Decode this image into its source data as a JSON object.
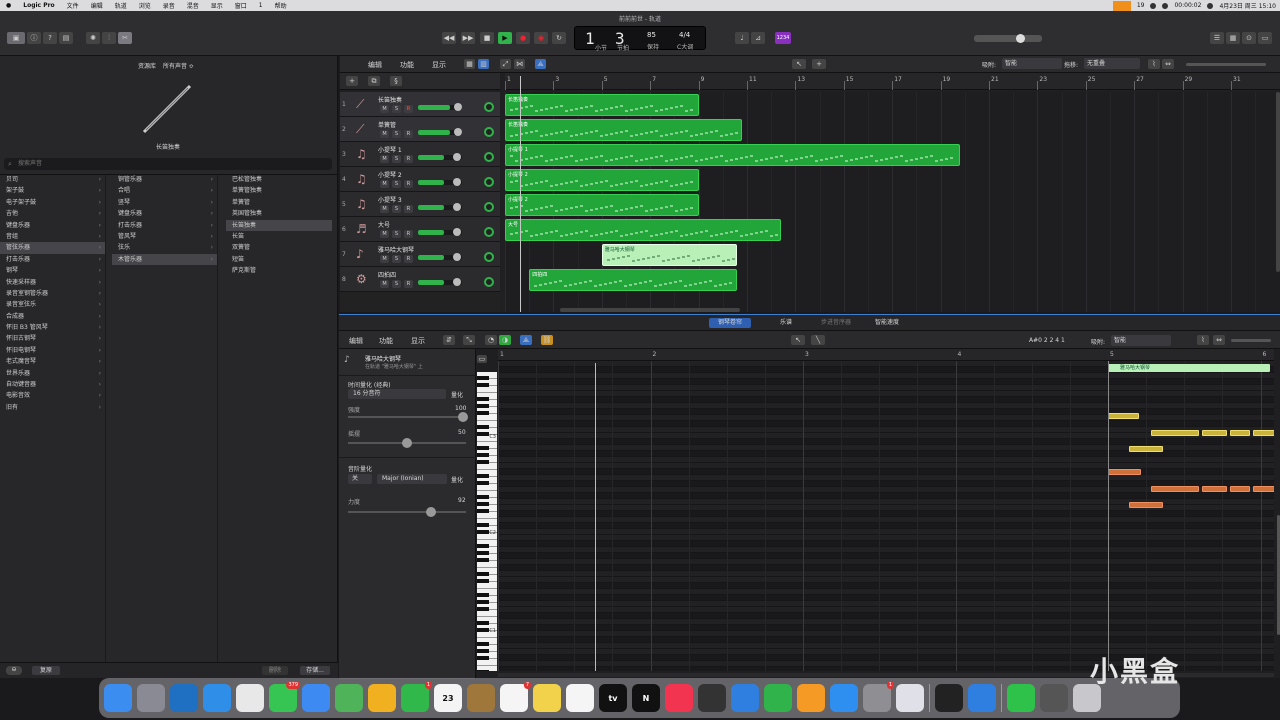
{
  "menubar": {
    "items": [
      "Logic Pro",
      "文件",
      "编辑",
      "轨道",
      "浏览",
      "录音",
      "混音",
      "显示",
      "窗口",
      "1",
      "帮助"
    ],
    "status": {
      "battery": "19",
      "date": "4月23日 周三 15:10",
      "clock": "00:00:02"
    }
  },
  "window": {
    "title": "前前前世 - 轨道"
  },
  "lcd": {
    "bar": "1",
    "beat": "3",
    "tempo": "85",
    "time_sig": "4/4",
    "key": "C大调",
    "bar_label": "小节",
    "beat_label": "节拍",
    "tempo_label": "保持"
  },
  "count_in": "1234",
  "library": {
    "header": "资源库",
    "filter": "所有声音 ≎",
    "instrument_name": "长笛独奏",
    "search_placeholder": "搜索声音",
    "col1": [
      "贝司",
      "架子鼓",
      "电子架子鼓",
      "吉他",
      "键盘乐器",
      "音组",
      "管弦乐器",
      "打击乐器",
      "钢琴",
      "快速采样器",
      "录音室钢管乐器",
      "录音室弦乐",
      "合成器",
      "怀旧 B3 管风琴",
      "怀旧古钢琴",
      "怀旧电钢琴",
      "老式魔音琴",
      "世界乐器",
      "自动键音器",
      "电影音效",
      "旧有"
    ],
    "col2": [
      "铜管乐器",
      "合唱",
      "竖琴",
      "键盘乐器",
      "打击乐器",
      "管风琴",
      "弦乐",
      "木管乐器"
    ],
    "col3": [
      "巴松管独奏",
      "单簧管独奏",
      "单簧管",
      "英国管独奏",
      "长笛独奏",
      "长笛",
      "双簧管",
      "短笛",
      "萨克斯管"
    ],
    "selected": {
      "col1": "管弦乐器",
      "col2": "木管乐器",
      "col3": "长笛独奏"
    },
    "footer": {
      "revert": "复原",
      "delete": "删除",
      "save": "存储..."
    }
  },
  "arrange": {
    "menus": [
      "编辑",
      "功能",
      "显示"
    ],
    "snap_label": "吸附:",
    "snap_value": "智能",
    "drag_label": "拖移:",
    "drag_value": "无重叠",
    "ruler": [
      "1",
      "3",
      "5",
      "7",
      "9",
      "11",
      "13",
      "15",
      "17",
      "19",
      "21",
      "23",
      "25",
      "27",
      "29",
      "31"
    ],
    "tracks": [
      {
        "num": "1",
        "name": "长笛独奏"
      },
      {
        "num": "2",
        "name": "单簧管"
      },
      {
        "num": "3",
        "name": "小提琴 1"
      },
      {
        "num": "4",
        "name": "小提琴 2"
      },
      {
        "num": "5",
        "name": "小提琴 3"
      },
      {
        "num": "6",
        "name": "大号"
      },
      {
        "num": "7",
        "name": "雅马哈大钢琴"
      },
      {
        "num": "8",
        "name": "四拍四"
      }
    ],
    "regions": [
      {
        "label": "长笛独奏",
        "track": 0,
        "start": 1,
        "end": 9
      },
      {
        "label": "长笛独奏",
        "track": 1,
        "start": 1,
        "end": 10.8
      },
      {
        "label": "小提琴 1",
        "track": 2,
        "start": 1,
        "end": 19.8
      },
      {
        "label": "小提琴 2",
        "track": 3,
        "start": 1,
        "end": 9
      },
      {
        "label": "小提琴 2",
        "track": 4,
        "start": 1,
        "end": 9
      },
      {
        "label": "大号",
        "track": 5,
        "start": 1,
        "end": 12.4
      },
      {
        "label": "雅马哈大钢琴",
        "track": 6,
        "start": 5,
        "end": 10.6,
        "light": true
      },
      {
        "label": "四拍四",
        "track": 7,
        "start": 2,
        "end": 10.6
      }
    ]
  },
  "pianoroll": {
    "tabs": [
      "钢琴卷帘",
      "乐谱",
      "步进音序器",
      "智能速度"
    ],
    "active_tab": "钢琴卷帘",
    "menus": [
      "编辑",
      "功能",
      "显示"
    ],
    "position": "A#0  2 2 4 1",
    "snap_label": "吸附:",
    "snap_value": "智能",
    "region_name": "雅马哈大钢琴",
    "region_sub": "在轨道 \"雅马哈大钢琴\" 上",
    "time_quantize_label": "时间量化 (经典)",
    "time_quantize_value": "16 分音符",
    "quantize_btn": "量化",
    "strength_label": "强度",
    "strength_value": "100",
    "swing_label": "摇摆",
    "swing_value": "50",
    "scale_quantize_label": "音阶量化",
    "scale_off": "关",
    "scale_value": "Major (Ionian)",
    "velocity_label": "力度",
    "velocity_value": "92",
    "ruler": [
      "1",
      "2",
      "3",
      "4",
      "5",
      "6"
    ],
    "octaves": [
      "C3",
      "C2",
      "C1"
    ],
    "region_label": "雅马哈大钢琴",
    "notes": [
      {
        "beat": 0,
        "len": 1.5,
        "row": 0,
        "color": "#c9b33a"
      },
      {
        "beat": 8,
        "len": 1,
        "row": 0,
        "color": "#c9b33a"
      },
      {
        "beat": 2,
        "len": 2.3,
        "row": 1,
        "color": "#c9b33a"
      },
      {
        "beat": 4.4,
        "len": 1.2,
        "row": 1,
        "color": "#c9b33a"
      },
      {
        "beat": 5.7,
        "len": 1,
        "row": 1,
        "color": "#c9b33a"
      },
      {
        "beat": 6.8,
        "len": 1.2,
        "row": 1,
        "color": "#c9b33a"
      },
      {
        "beat": 1,
        "len": 1.6,
        "row": 2,
        "color": "#c9b33a"
      },
      {
        "beat": 0,
        "len": 1.6,
        "row": 3,
        "color": "#d0703a"
      },
      {
        "beat": 8,
        "len": 1,
        "row": 3,
        "color": "#d0703a"
      },
      {
        "beat": 2,
        "len": 2.3,
        "row": 4,
        "color": "#d0703a"
      },
      {
        "beat": 4.4,
        "len": 1.2,
        "row": 4,
        "color": "#d0703a"
      },
      {
        "beat": 5.7,
        "len": 1,
        "row": 4,
        "color": "#d0703a"
      },
      {
        "beat": 6.8,
        "len": 1.2,
        "row": 4,
        "color": "#d0703a"
      },
      {
        "beat": 1,
        "len": 1.6,
        "row": 5,
        "color": "#d0703a"
      }
    ]
  },
  "dock": [
    {
      "name": "finder",
      "color": "#3b8df0"
    },
    {
      "name": "launchpad",
      "color": "#8a8a95"
    },
    {
      "name": "vscode",
      "color": "#1f6fc2"
    },
    {
      "name": "safari",
      "color": "#2f8fe8"
    },
    {
      "name": "chrome",
      "color": "#e8e8e8"
    },
    {
      "name": "messages",
      "color": "#36c452",
      "badge": "379"
    },
    {
      "name": "mail",
      "color": "#3d8bf2"
    },
    {
      "name": "maps",
      "color": "#4fb35a"
    },
    {
      "name": "photos",
      "color": "#f0b020"
    },
    {
      "name": "facetime",
      "color": "#30b84a",
      "badge": "1"
    },
    {
      "name": "calendar",
      "color": "#f4f4f4",
      "text": "23"
    },
    {
      "name": "notes-brown",
      "color": "#a0773a"
    },
    {
      "name": "reminders",
      "color": "#f5f5f5",
      "badge": "7"
    },
    {
      "name": "notes",
      "color": "#f2d24a"
    },
    {
      "name": "freeform",
      "color": "#f5f5f5"
    },
    {
      "name": "tv",
      "color": "#111111",
      "text": "tv"
    },
    {
      "name": "netflix",
      "color": "#111111",
      "text": "N"
    },
    {
      "name": "music",
      "color": "#f23450"
    },
    {
      "name": "logic",
      "color": "#333333"
    },
    {
      "name": "keynote",
      "color": "#2f7fe0"
    },
    {
      "name": "numbers",
      "color": "#2fb34a"
    },
    {
      "name": "pages",
      "color": "#f59a25"
    },
    {
      "name": "appstore",
      "color": "#2f8ff0"
    },
    {
      "name": "settings",
      "color": "#8e8e93",
      "badge": "1"
    },
    {
      "name": "iphone-mirror",
      "color": "#e0e0e8"
    },
    {
      "name": "capture",
      "color": "#222222"
    },
    {
      "name": "todo",
      "color": "#2f7fe0"
    },
    {
      "name": "wechat",
      "color": "#2fc24a"
    },
    {
      "name": "stack",
      "color": "#555555"
    },
    {
      "name": "trash",
      "color": "#c8c8cc"
    }
  ],
  "watermark": "小黑盒"
}
